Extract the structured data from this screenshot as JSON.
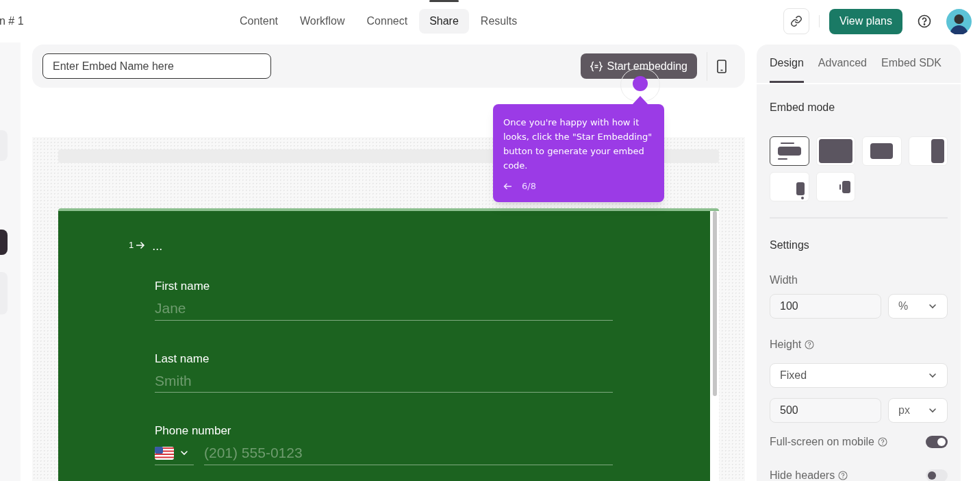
{
  "header": {
    "title": "n # 1",
    "tabs": [
      {
        "label": "Content",
        "selected": false
      },
      {
        "label": "Workflow",
        "selected": false
      },
      {
        "label": "Connect",
        "selected": false
      },
      {
        "label": "Share",
        "selected": true
      },
      {
        "label": "Results",
        "selected": false
      }
    ],
    "view_plans": "View plans"
  },
  "sidebar": {
    "items": [
      {
        "selected": false
      },
      {
        "selected": true
      },
      {
        "selected": false
      }
    ]
  },
  "toolbar": {
    "name_field": {
      "placeholder": "Enter Embed Name here"
    },
    "start_button": "Start embedding"
  },
  "tooltip": {
    "text": "Once you're happy with how it looks, click the \"Star Embedding\" button to generate your embed code.",
    "step": "6/8"
  },
  "form": {
    "question_number": "1",
    "question_title": "...",
    "fields": [
      {
        "kind": "text",
        "label": "First name",
        "placeholder": "Jane"
      },
      {
        "kind": "text",
        "label": "Last name",
        "placeholder": "Smith"
      },
      {
        "kind": "phone",
        "label": "Phone number",
        "placeholder": "(201) 555-0123"
      }
    ]
  },
  "panel": {
    "tabs": [
      {
        "label": "Design",
        "selected": true
      },
      {
        "label": "Advanced",
        "selected": false
      },
      {
        "label": "Embed SDK",
        "selected": false
      }
    ],
    "embed_mode": {
      "title": "Embed mode",
      "modes": [
        {
          "kind": "standard",
          "selected": true
        },
        {
          "kind": "full",
          "selected": false
        },
        {
          "kind": "popup",
          "selected": false
        },
        {
          "kind": "slider",
          "selected": false
        },
        {
          "kind": "popover",
          "selected": false
        },
        {
          "kind": "sidetab",
          "selected": false
        }
      ]
    },
    "settings": {
      "title": "Settings",
      "width": {
        "label": "Width",
        "value": "100",
        "unit": "%"
      },
      "height": {
        "label": "Height",
        "mode": "Fixed",
        "value": "500",
        "unit": "px"
      },
      "toggles": [
        {
          "label": "Full-screen on mobile",
          "on": true
        },
        {
          "label": "Hide headers",
          "on": false
        }
      ]
    }
  }
}
